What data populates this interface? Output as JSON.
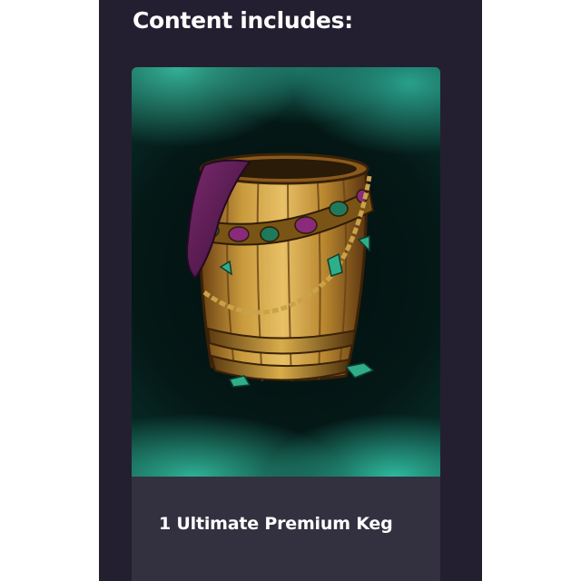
{
  "section": {
    "heading": "Content includes:"
  },
  "item": {
    "image_icon": "barrel-keg-icon",
    "caption": "1 Ultimate Premium Keg"
  },
  "colors": {
    "panel_bg": "#231f30",
    "card_caption_bg": "#33303f",
    "smoke_accent": "#3cc8aa",
    "heading_text": "#ffffff"
  }
}
